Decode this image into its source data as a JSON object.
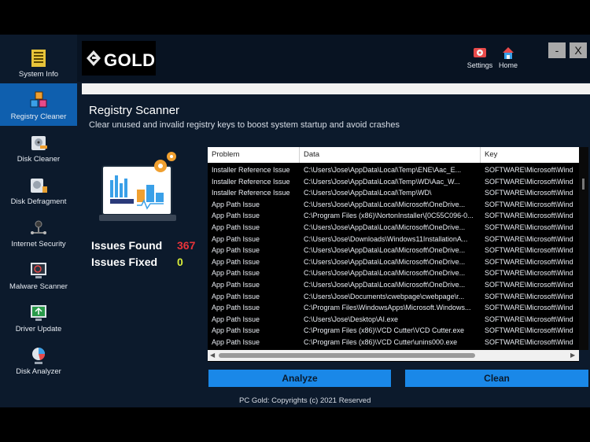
{
  "sidebar": {
    "items": [
      {
        "label": "System Info",
        "icon": "system-info-icon"
      },
      {
        "label": "Registry Cleaner",
        "icon": "registry-cubes-icon"
      },
      {
        "label": "Disk Cleaner",
        "icon": "disk-cleaner-icon"
      },
      {
        "label": "Disk Defragment",
        "icon": "disk-defragment-icon"
      },
      {
        "label": "Internet Security",
        "icon": "internet-security-icon"
      },
      {
        "label": "Malware Scanner",
        "icon": "malware-scanner-icon"
      },
      {
        "label": "Driver Update",
        "icon": "driver-update-icon"
      },
      {
        "label": "Disk Analyzer",
        "icon": "disk-analyzer-icon"
      }
    ],
    "active_index": 1
  },
  "header": {
    "logo_text": "GOLD",
    "settings_label": "Settings",
    "home_label": "Home",
    "minimize_label": "-",
    "close_label": "X"
  },
  "page": {
    "title": "Registry Scanner",
    "subtitle": "Clear unused and invalid registry keys to boost system startup and avoid crashes"
  },
  "stats": {
    "issues_found_label": "Issues Found",
    "issues_found_value": "367",
    "issues_fixed_label": "Issues Fixed",
    "issues_fixed_value": "0"
  },
  "table": {
    "columns": [
      "Problem",
      "Data",
      "Key"
    ],
    "rows": [
      [
        "Installer Reference Issue",
        "C:\\Users\\Jose\\AppData\\Local\\Temp\\ENE\\Aac_E...",
        "SOFTWARE\\Microsoft\\Wind"
      ],
      [
        "Installer Reference Issue",
        "C:\\Users\\Jose\\AppData\\Local\\Temp\\WD\\Aac_W...",
        "SOFTWARE\\Microsoft\\Wind"
      ],
      [
        "Installer Reference Issue",
        "C:\\Users\\Jose\\AppData\\Local\\Temp\\WD\\",
        "SOFTWARE\\Microsoft\\Wind"
      ],
      [
        "App Path Issue",
        "C:\\Users\\Jose\\AppData\\Local\\Microsoft\\OneDrive...",
        "SOFTWARE\\Microsoft\\Wind"
      ],
      [
        "App Path Issue",
        "C:\\Program Files (x86)\\NortonInstaller\\{0C55C096-0...",
        "SOFTWARE\\Microsoft\\Wind"
      ],
      [
        "App Path Issue",
        "C:\\Users\\Jose\\AppData\\Local\\Microsoft\\OneDrive...",
        "SOFTWARE\\Microsoft\\Wind"
      ],
      [
        "App Path Issue",
        "C:\\Users\\Jose\\Downloads\\Windows11InstallationA...",
        "SOFTWARE\\Microsoft\\Wind"
      ],
      [
        "App Path Issue",
        "C:\\Users\\Jose\\AppData\\Local\\Microsoft\\OneDrive...",
        "SOFTWARE\\Microsoft\\Wind"
      ],
      [
        "App Path Issue",
        "C:\\Users\\Jose\\AppData\\Local\\Microsoft\\OneDrive...",
        "SOFTWARE\\Microsoft\\Wind"
      ],
      [
        "App Path Issue",
        "C:\\Users\\Jose\\AppData\\Local\\Microsoft\\OneDrive...",
        "SOFTWARE\\Microsoft\\Wind"
      ],
      [
        "App Path Issue",
        "C:\\Users\\Jose\\AppData\\Local\\Microsoft\\OneDrive...",
        "SOFTWARE\\Microsoft\\Wind"
      ],
      [
        "App Path Issue",
        "C:\\Users\\Jose\\Documents\\cwebpage\\cwebpage\\r...",
        "SOFTWARE\\Microsoft\\Wind"
      ],
      [
        "App Path Issue",
        "C:\\Program Files\\WindowsApps\\Microsoft.Windows...",
        "SOFTWARE\\Microsoft\\Wind"
      ],
      [
        "App Path Issue",
        "C:\\Users\\Jose\\Desktop\\AI.exe",
        "SOFTWARE\\Microsoft\\Wind"
      ],
      [
        "App Path Issue",
        "C:\\Program Files (x86)\\VCD Cutter\\VCD Cutter.exe",
        "SOFTWARE\\Microsoft\\Wind"
      ],
      [
        "App Path Issue",
        "C:\\Program Files (x86)\\VCD Cutter\\unins000.exe",
        "SOFTWARE\\Microsoft\\Wind"
      ]
    ]
  },
  "actions": {
    "analyze_label": "Analyze",
    "clean_label": "Clean"
  },
  "footer": {
    "text": "PC Gold: Copyrights (c) 2021 Reserved"
  },
  "colors": {
    "accent": "#1a88e8",
    "active_nav": "#0f5fae",
    "issues_found": "#e8343a",
    "issues_fixed": "#d8ec3a",
    "background": "#0c1a2c"
  }
}
